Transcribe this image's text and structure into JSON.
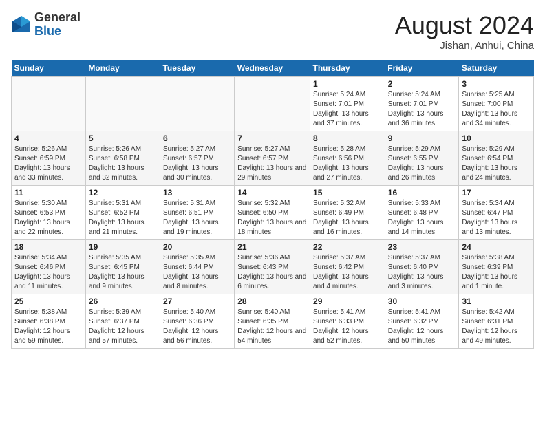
{
  "header": {
    "logo_general": "General",
    "logo_blue": "Blue",
    "month_year": "August 2024",
    "location": "Jishan, Anhui, China"
  },
  "weekdays": [
    "Sunday",
    "Monday",
    "Tuesday",
    "Wednesday",
    "Thursday",
    "Friday",
    "Saturday"
  ],
  "weeks": [
    [
      {
        "day": "",
        "info": ""
      },
      {
        "day": "",
        "info": ""
      },
      {
        "day": "",
        "info": ""
      },
      {
        "day": "",
        "info": ""
      },
      {
        "day": "1",
        "info": "Sunrise: 5:24 AM\nSunset: 7:01 PM\nDaylight: 13 hours and 37 minutes."
      },
      {
        "day": "2",
        "info": "Sunrise: 5:24 AM\nSunset: 7:01 PM\nDaylight: 13 hours and 36 minutes."
      },
      {
        "day": "3",
        "info": "Sunrise: 5:25 AM\nSunset: 7:00 PM\nDaylight: 13 hours and 34 minutes."
      }
    ],
    [
      {
        "day": "4",
        "info": "Sunrise: 5:26 AM\nSunset: 6:59 PM\nDaylight: 13 hours and 33 minutes."
      },
      {
        "day": "5",
        "info": "Sunrise: 5:26 AM\nSunset: 6:58 PM\nDaylight: 13 hours and 32 minutes."
      },
      {
        "day": "6",
        "info": "Sunrise: 5:27 AM\nSunset: 6:57 PM\nDaylight: 13 hours and 30 minutes."
      },
      {
        "day": "7",
        "info": "Sunrise: 5:27 AM\nSunset: 6:57 PM\nDaylight: 13 hours and 29 minutes."
      },
      {
        "day": "8",
        "info": "Sunrise: 5:28 AM\nSunset: 6:56 PM\nDaylight: 13 hours and 27 minutes."
      },
      {
        "day": "9",
        "info": "Sunrise: 5:29 AM\nSunset: 6:55 PM\nDaylight: 13 hours and 26 minutes."
      },
      {
        "day": "10",
        "info": "Sunrise: 5:29 AM\nSunset: 6:54 PM\nDaylight: 13 hours and 24 minutes."
      }
    ],
    [
      {
        "day": "11",
        "info": "Sunrise: 5:30 AM\nSunset: 6:53 PM\nDaylight: 13 hours and 22 minutes."
      },
      {
        "day": "12",
        "info": "Sunrise: 5:31 AM\nSunset: 6:52 PM\nDaylight: 13 hours and 21 minutes."
      },
      {
        "day": "13",
        "info": "Sunrise: 5:31 AM\nSunset: 6:51 PM\nDaylight: 13 hours and 19 minutes."
      },
      {
        "day": "14",
        "info": "Sunrise: 5:32 AM\nSunset: 6:50 PM\nDaylight: 13 hours and 18 minutes."
      },
      {
        "day": "15",
        "info": "Sunrise: 5:32 AM\nSunset: 6:49 PM\nDaylight: 13 hours and 16 minutes."
      },
      {
        "day": "16",
        "info": "Sunrise: 5:33 AM\nSunset: 6:48 PM\nDaylight: 13 hours and 14 minutes."
      },
      {
        "day": "17",
        "info": "Sunrise: 5:34 AM\nSunset: 6:47 PM\nDaylight: 13 hours and 13 minutes."
      }
    ],
    [
      {
        "day": "18",
        "info": "Sunrise: 5:34 AM\nSunset: 6:46 PM\nDaylight: 13 hours and 11 minutes."
      },
      {
        "day": "19",
        "info": "Sunrise: 5:35 AM\nSunset: 6:45 PM\nDaylight: 13 hours and 9 minutes."
      },
      {
        "day": "20",
        "info": "Sunrise: 5:35 AM\nSunset: 6:44 PM\nDaylight: 13 hours and 8 minutes."
      },
      {
        "day": "21",
        "info": "Sunrise: 5:36 AM\nSunset: 6:43 PM\nDaylight: 13 hours and 6 minutes."
      },
      {
        "day": "22",
        "info": "Sunrise: 5:37 AM\nSunset: 6:42 PM\nDaylight: 13 hours and 4 minutes."
      },
      {
        "day": "23",
        "info": "Sunrise: 5:37 AM\nSunset: 6:40 PM\nDaylight: 13 hours and 3 minutes."
      },
      {
        "day": "24",
        "info": "Sunrise: 5:38 AM\nSunset: 6:39 PM\nDaylight: 13 hours and 1 minute."
      }
    ],
    [
      {
        "day": "25",
        "info": "Sunrise: 5:38 AM\nSunset: 6:38 PM\nDaylight: 12 hours and 59 minutes."
      },
      {
        "day": "26",
        "info": "Sunrise: 5:39 AM\nSunset: 6:37 PM\nDaylight: 12 hours and 57 minutes."
      },
      {
        "day": "27",
        "info": "Sunrise: 5:40 AM\nSunset: 6:36 PM\nDaylight: 12 hours and 56 minutes."
      },
      {
        "day": "28",
        "info": "Sunrise: 5:40 AM\nSunset: 6:35 PM\nDaylight: 12 hours and 54 minutes."
      },
      {
        "day": "29",
        "info": "Sunrise: 5:41 AM\nSunset: 6:33 PM\nDaylight: 12 hours and 52 minutes."
      },
      {
        "day": "30",
        "info": "Sunrise: 5:41 AM\nSunset: 6:32 PM\nDaylight: 12 hours and 50 minutes."
      },
      {
        "day": "31",
        "info": "Sunrise: 5:42 AM\nSunset: 6:31 PM\nDaylight: 12 hours and 49 minutes."
      }
    ]
  ]
}
